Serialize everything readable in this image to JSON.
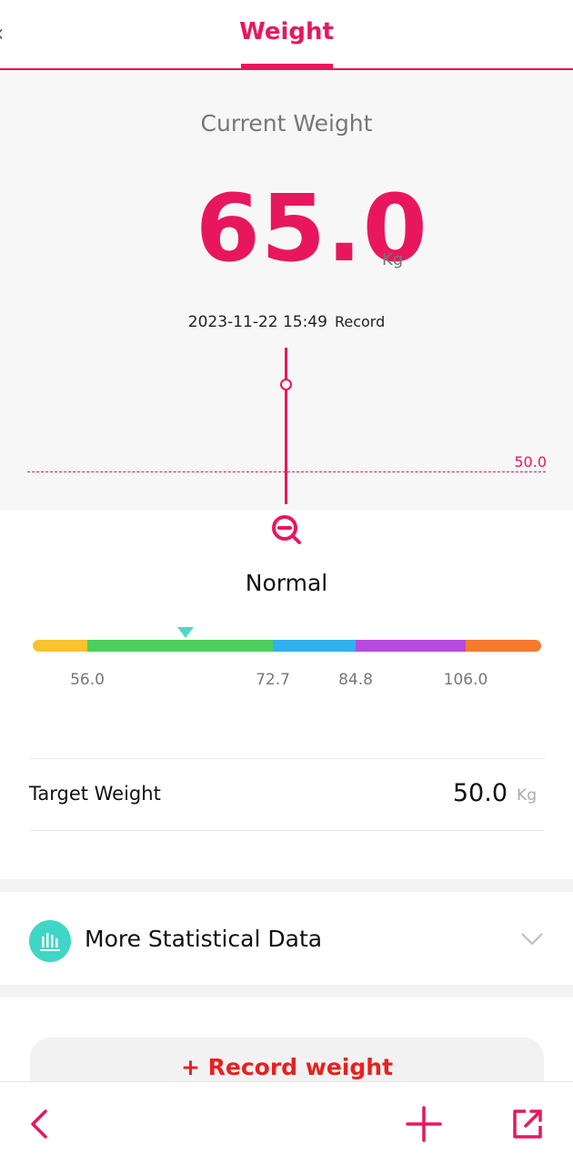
{
  "header": {
    "back_glyph": "‹",
    "title": "Weight"
  },
  "hero": {
    "label": "Current Weight",
    "value": "65.0",
    "unit": "Kg",
    "datetime": "2023-11-22 15:49",
    "record_label": "Record",
    "target_line_label": "50.0"
  },
  "status": "Normal",
  "bmi_bar": {
    "segments": [
      {
        "color": "#f9c22e"
      },
      {
        "color": "#4ccf5b"
      },
      {
        "color": "#2fb2f0"
      },
      {
        "color": "#b84ae0"
      },
      {
        "color": "#f47a2e"
      }
    ],
    "ticks": [
      "56.0",
      "72.7",
      "84.8",
      "106.0"
    ],
    "marker_color": "#4dd9c8"
  },
  "target": {
    "label": "Target Weight",
    "value": "50.0",
    "unit": "Kg"
  },
  "stats": {
    "label": "More Statistical Data",
    "icon": "bar-chart-icon"
  },
  "record_button": {
    "label": "+ Record weight"
  },
  "bottom_nav": {
    "back_icon": "chevron-left-icon",
    "add_icon": "plus-icon",
    "share_icon": "share-external-icon"
  },
  "colors": {
    "accent": "#e8175d",
    "teal": "#3fd6c6",
    "record_red": "#e82020"
  }
}
